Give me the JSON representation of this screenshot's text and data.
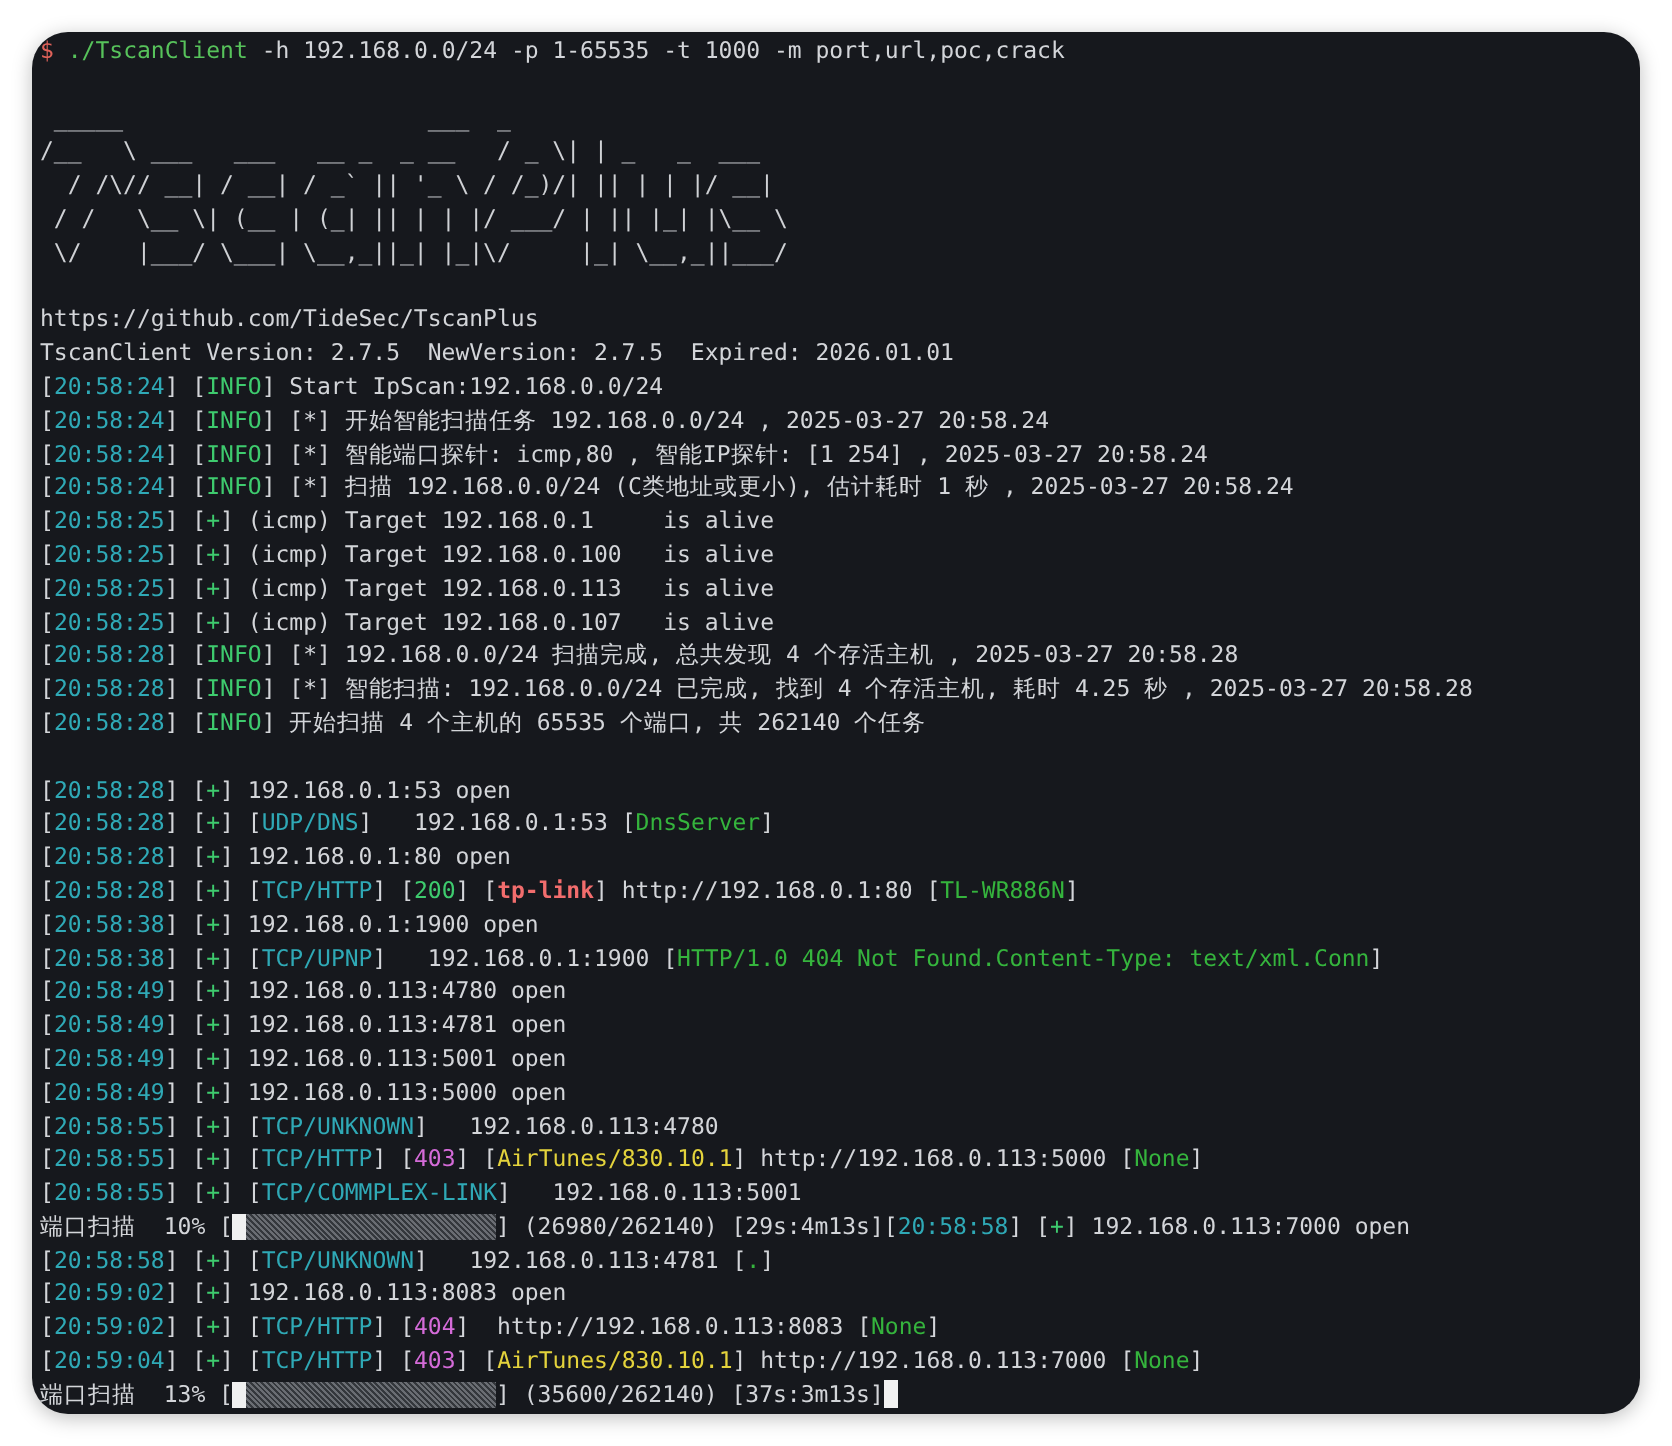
{
  "terminal": {
    "prompt": "$",
    "command": "./TscanClient",
    "arguments": " -h 192.168.0.0/24 -p 1-65535 -t 1000 -m port,url,poc,crack",
    "banner": [
      " _____                      ___  _",
      "/__   \\ ___   ___   __ _  _ __   / _ \\| | _   _  ___",
      "  / /\\// __| / __| / _` || '_ \\ / /_)/| || | | |/ __|",
      " / /   \\__ \\| (__ | (_| || | | |/ ___/ | || |_| |\\__ \\",
      " \\/    |___/ \\___| \\__,_||_| |_|\\/     |_| \\__,_||___/"
    ],
    "lines": [
      {
        "kind": "text",
        "segments": [
          {
            "kind": "plain",
            "text": "https://github.com/TideSec/TscanPlus"
          }
        ]
      },
      {
        "kind": "text",
        "segments": [
          {
            "kind": "plain",
            "text": "TscanClient Version: 2.7.5  NewVersion: 2.7.5  Expired: 2026.01.01"
          }
        ]
      },
      {
        "kind": "text",
        "segments": [
          {
            "kind": "plain",
            "text": "["
          },
          {
            "kind": "time",
            "text": "20:58:24"
          },
          {
            "kind": "plain",
            "text": "] ["
          },
          {
            "kind": "info",
            "text": "INFO"
          },
          {
            "kind": "plain",
            "text": "] Start IpScan:192.168.0.0/24"
          }
        ]
      },
      {
        "kind": "text",
        "segments": [
          {
            "kind": "plain",
            "text": "["
          },
          {
            "kind": "time",
            "text": "20:58:24"
          },
          {
            "kind": "plain",
            "text": "] ["
          },
          {
            "kind": "info",
            "text": "INFO"
          },
          {
            "kind": "plain",
            "text": "] [*] 开始智能扫描任务 192.168.0.0/24 , 2025-03-27 20:58.24"
          }
        ]
      },
      {
        "kind": "text",
        "segments": [
          {
            "kind": "plain",
            "text": "["
          },
          {
            "kind": "time",
            "text": "20:58:24"
          },
          {
            "kind": "plain",
            "text": "] ["
          },
          {
            "kind": "info",
            "text": "INFO"
          },
          {
            "kind": "plain",
            "text": "] [*] 智能端口探针: icmp,80 , 智能IP探针: [1 254] , 2025-03-27 20:58.24"
          }
        ]
      },
      {
        "kind": "text",
        "segments": [
          {
            "kind": "plain",
            "text": "["
          },
          {
            "kind": "time",
            "text": "20:58:24"
          },
          {
            "kind": "plain",
            "text": "] ["
          },
          {
            "kind": "info",
            "text": "INFO"
          },
          {
            "kind": "plain",
            "text": "] [*] 扫描 192.168.0.0/24 (C类地址或更小), 估计耗时 1 秒 , 2025-03-27 20:58.24"
          }
        ]
      },
      {
        "kind": "text",
        "segments": [
          {
            "kind": "plain",
            "text": "["
          },
          {
            "kind": "time",
            "text": "20:58:25"
          },
          {
            "kind": "plain",
            "text": "] ["
          },
          {
            "kind": "info",
            "text": "+"
          },
          {
            "kind": "plain",
            "text": "] (icmp) Target 192.168.0.1     is alive"
          }
        ]
      },
      {
        "kind": "text",
        "segments": [
          {
            "kind": "plain",
            "text": "["
          },
          {
            "kind": "time",
            "text": "20:58:25"
          },
          {
            "kind": "plain",
            "text": "] ["
          },
          {
            "kind": "info",
            "text": "+"
          },
          {
            "kind": "plain",
            "text": "] (icmp) Target 192.168.0.100   is alive"
          }
        ]
      },
      {
        "kind": "text",
        "segments": [
          {
            "kind": "plain",
            "text": "["
          },
          {
            "kind": "time",
            "text": "20:58:25"
          },
          {
            "kind": "plain",
            "text": "] ["
          },
          {
            "kind": "info",
            "text": "+"
          },
          {
            "kind": "plain",
            "text": "] (icmp) Target 192.168.0.113   is alive"
          }
        ]
      },
      {
        "kind": "text",
        "segments": [
          {
            "kind": "plain",
            "text": "["
          },
          {
            "kind": "time",
            "text": "20:58:25"
          },
          {
            "kind": "plain",
            "text": "] ["
          },
          {
            "kind": "info",
            "text": "+"
          },
          {
            "kind": "plain",
            "text": "] (icmp) Target 192.168.0.107   is alive"
          }
        ]
      },
      {
        "kind": "text",
        "segments": [
          {
            "kind": "plain",
            "text": "["
          },
          {
            "kind": "time",
            "text": "20:58:28"
          },
          {
            "kind": "plain",
            "text": "] ["
          },
          {
            "kind": "info",
            "text": "INFO"
          },
          {
            "kind": "plain",
            "text": "] [*] 192.168.0.0/24 扫描完成, 总共发现 4 个存活主机 , 2025-03-27 20:58.28"
          }
        ]
      },
      {
        "kind": "text",
        "segments": [
          {
            "kind": "plain",
            "text": "["
          },
          {
            "kind": "time",
            "text": "20:58:28"
          },
          {
            "kind": "plain",
            "text": "] ["
          },
          {
            "kind": "info",
            "text": "INFO"
          },
          {
            "kind": "plain",
            "text": "] [*] 智能扫描: 192.168.0.0/24 已完成, 找到 4 个存活主机, 耗时 4.25 秒 , 2025-03-27 20:58.28"
          }
        ]
      },
      {
        "kind": "text",
        "segments": [
          {
            "kind": "plain",
            "text": "["
          },
          {
            "kind": "time",
            "text": "20:58:28"
          },
          {
            "kind": "plain",
            "text": "] ["
          },
          {
            "kind": "info",
            "text": "INFO"
          },
          {
            "kind": "plain",
            "text": "] 开始扫描 4 个主机的 65535 个端口, 共 262140 个任务"
          }
        ]
      },
      {
        "kind": "blank"
      },
      {
        "kind": "text",
        "segments": [
          {
            "kind": "plain",
            "text": "["
          },
          {
            "kind": "time",
            "text": "20:58:28"
          },
          {
            "kind": "plain",
            "text": "] ["
          },
          {
            "kind": "info",
            "text": "+"
          },
          {
            "kind": "plain",
            "text": "] 192.168.0.1:53 open"
          }
        ]
      },
      {
        "kind": "text",
        "segments": [
          {
            "kind": "plain",
            "text": "["
          },
          {
            "kind": "time",
            "text": "20:58:28"
          },
          {
            "kind": "plain",
            "text": "] ["
          },
          {
            "kind": "info",
            "text": "+"
          },
          {
            "kind": "plain",
            "text": "] ["
          },
          {
            "kind": "tag",
            "text": "UDP/DNS"
          },
          {
            "kind": "plain",
            "text": "]   192.168.0.1:53 ["
          },
          {
            "kind": "green",
            "text": "DnsServer"
          },
          {
            "kind": "plain",
            "text": "]"
          }
        ]
      },
      {
        "kind": "text",
        "segments": [
          {
            "kind": "plain",
            "text": "["
          },
          {
            "kind": "time",
            "text": "20:58:28"
          },
          {
            "kind": "plain",
            "text": "] ["
          },
          {
            "kind": "info",
            "text": "+"
          },
          {
            "kind": "plain",
            "text": "] 192.168.0.1:80 open"
          }
        ]
      },
      {
        "kind": "text",
        "segments": [
          {
            "kind": "plain",
            "text": "["
          },
          {
            "kind": "time",
            "text": "20:58:28"
          },
          {
            "kind": "plain",
            "text": "] ["
          },
          {
            "kind": "info",
            "text": "+"
          },
          {
            "kind": "plain",
            "text": "] ["
          },
          {
            "kind": "tag",
            "text": "TCP/HTTP"
          },
          {
            "kind": "plain",
            "text": "] ["
          },
          {
            "kind": "info",
            "text": "200"
          },
          {
            "kind": "plain",
            "text": "] ["
          },
          {
            "kind": "red",
            "text": "tp-link"
          },
          {
            "kind": "plain",
            "text": "] http://192.168.0.1:80 ["
          },
          {
            "kind": "green",
            "text": "TL-WR886N"
          },
          {
            "kind": "plain",
            "text": "]"
          }
        ]
      },
      {
        "kind": "text",
        "segments": [
          {
            "kind": "plain",
            "text": "["
          },
          {
            "kind": "time",
            "text": "20:58:38"
          },
          {
            "kind": "plain",
            "text": "] ["
          },
          {
            "kind": "info",
            "text": "+"
          },
          {
            "kind": "plain",
            "text": "] 192.168.0.1:1900 open"
          }
        ]
      },
      {
        "kind": "text",
        "segments": [
          {
            "kind": "plain",
            "text": "["
          },
          {
            "kind": "time",
            "text": "20:58:38"
          },
          {
            "kind": "plain",
            "text": "] ["
          },
          {
            "kind": "info",
            "text": "+"
          },
          {
            "kind": "plain",
            "text": "] ["
          },
          {
            "kind": "tag",
            "text": "TCP/UPNP"
          },
          {
            "kind": "plain",
            "text": "]   192.168.0.1:1900 ["
          },
          {
            "kind": "green",
            "text": "HTTP/1.0 404 Not Found.Content-Type: text/xml.Conn"
          },
          {
            "kind": "plain",
            "text": "]"
          }
        ]
      },
      {
        "kind": "text",
        "segments": [
          {
            "kind": "plain",
            "text": "["
          },
          {
            "kind": "time",
            "text": "20:58:49"
          },
          {
            "kind": "plain",
            "text": "] ["
          },
          {
            "kind": "info",
            "text": "+"
          },
          {
            "kind": "plain",
            "text": "] 192.168.0.113:4780 open"
          }
        ]
      },
      {
        "kind": "text",
        "segments": [
          {
            "kind": "plain",
            "text": "["
          },
          {
            "kind": "time",
            "text": "20:58:49"
          },
          {
            "kind": "plain",
            "text": "] ["
          },
          {
            "kind": "info",
            "text": "+"
          },
          {
            "kind": "plain",
            "text": "] 192.168.0.113:4781 open"
          }
        ]
      },
      {
        "kind": "text",
        "segments": [
          {
            "kind": "plain",
            "text": "["
          },
          {
            "kind": "time",
            "text": "20:58:49"
          },
          {
            "kind": "plain",
            "text": "] ["
          },
          {
            "kind": "info",
            "text": "+"
          },
          {
            "kind": "plain",
            "text": "] 192.168.0.113:5001 open"
          }
        ]
      },
      {
        "kind": "text",
        "segments": [
          {
            "kind": "plain",
            "text": "["
          },
          {
            "kind": "time",
            "text": "20:58:49"
          },
          {
            "kind": "plain",
            "text": "] ["
          },
          {
            "kind": "info",
            "text": "+"
          },
          {
            "kind": "plain",
            "text": "] 192.168.0.113:5000 open"
          }
        ]
      },
      {
        "kind": "text",
        "segments": [
          {
            "kind": "plain",
            "text": "["
          },
          {
            "kind": "time",
            "text": "20:58:55"
          },
          {
            "kind": "plain",
            "text": "] ["
          },
          {
            "kind": "info",
            "text": "+"
          },
          {
            "kind": "plain",
            "text": "] ["
          },
          {
            "kind": "tag",
            "text": "TCP/UNKNOWN"
          },
          {
            "kind": "plain",
            "text": "]   192.168.0.113:4780"
          }
        ]
      },
      {
        "kind": "text",
        "segments": [
          {
            "kind": "plain",
            "text": "["
          },
          {
            "kind": "time",
            "text": "20:58:55"
          },
          {
            "kind": "plain",
            "text": "] ["
          },
          {
            "kind": "info",
            "text": "+"
          },
          {
            "kind": "plain",
            "text": "] ["
          },
          {
            "kind": "tag",
            "text": "TCP/HTTP"
          },
          {
            "kind": "plain",
            "text": "] ["
          },
          {
            "kind": "magenta",
            "text": "403"
          },
          {
            "kind": "plain",
            "text": "] ["
          },
          {
            "kind": "yellow",
            "text": "AirTunes/830.10.1"
          },
          {
            "kind": "plain",
            "text": "] http://192.168.0.113:5000 ["
          },
          {
            "kind": "green",
            "text": "None"
          },
          {
            "kind": "plain",
            "text": "]"
          }
        ]
      },
      {
        "kind": "text",
        "segments": [
          {
            "kind": "plain",
            "text": "["
          },
          {
            "kind": "time",
            "text": "20:58:55"
          },
          {
            "kind": "plain",
            "text": "] ["
          },
          {
            "kind": "info",
            "text": "+"
          },
          {
            "kind": "plain",
            "text": "] ["
          },
          {
            "kind": "tag",
            "text": "TCP/COMMPLEX-LINK"
          },
          {
            "kind": "plain",
            "text": "]   192.168.0.113:5001"
          }
        ]
      },
      {
        "kind": "progress",
        "before": [
          {
            "kind": "plain",
            "text": "端口扫描  10% ["
          }
        ],
        "level": 0.05,
        "after": [
          {
            "kind": "plain",
            "text": "] (26980/262140) [29s:4m13s]["
          },
          {
            "kind": "time",
            "text": "20:58:58"
          },
          {
            "kind": "plain",
            "text": "] ["
          },
          {
            "kind": "info",
            "text": "+"
          },
          {
            "kind": "plain",
            "text": "] 192.168.0.113:7000 open"
          }
        ]
      },
      {
        "kind": "text",
        "segments": [
          {
            "kind": "plain",
            "text": "["
          },
          {
            "kind": "time",
            "text": "20:58:58"
          },
          {
            "kind": "plain",
            "text": "] ["
          },
          {
            "kind": "info",
            "text": "+"
          },
          {
            "kind": "plain",
            "text": "] ["
          },
          {
            "kind": "tag",
            "text": "TCP/UNKNOWN"
          },
          {
            "kind": "plain",
            "text": "]   192.168.0.113:4781 ["
          },
          {
            "kind": "green",
            "text": "."
          },
          {
            "kind": "plain",
            "text": "]"
          }
        ]
      },
      {
        "kind": "text",
        "segments": [
          {
            "kind": "plain",
            "text": "["
          },
          {
            "kind": "time",
            "text": "20:59:02"
          },
          {
            "kind": "plain",
            "text": "] ["
          },
          {
            "kind": "info",
            "text": "+"
          },
          {
            "kind": "plain",
            "text": "] 192.168.0.113:8083 open"
          }
        ]
      },
      {
        "kind": "text",
        "segments": [
          {
            "kind": "plain",
            "text": "["
          },
          {
            "kind": "time",
            "text": "20:59:02"
          },
          {
            "kind": "plain",
            "text": "] ["
          },
          {
            "kind": "info",
            "text": "+"
          },
          {
            "kind": "plain",
            "text": "] ["
          },
          {
            "kind": "tag",
            "text": "TCP/HTTP"
          },
          {
            "kind": "plain",
            "text": "] ["
          },
          {
            "kind": "magenta",
            "text": "404"
          },
          {
            "kind": "plain",
            "text": "]  http://192.168.0.113:8083 ["
          },
          {
            "kind": "green",
            "text": "None"
          },
          {
            "kind": "plain",
            "text": "]"
          }
        ]
      },
      {
        "kind": "text",
        "segments": [
          {
            "kind": "plain",
            "text": "["
          },
          {
            "kind": "time",
            "text": "20:59:04"
          },
          {
            "kind": "plain",
            "text": "] ["
          },
          {
            "kind": "info",
            "text": "+"
          },
          {
            "kind": "plain",
            "text": "] ["
          },
          {
            "kind": "tag",
            "text": "TCP/HTTP"
          },
          {
            "kind": "plain",
            "text": "] ["
          },
          {
            "kind": "magenta",
            "text": "403"
          },
          {
            "kind": "plain",
            "text": "] ["
          },
          {
            "kind": "yellow",
            "text": "AirTunes/830.10.1"
          },
          {
            "kind": "plain",
            "text": "] http://192.168.0.113:7000 ["
          },
          {
            "kind": "green",
            "text": "None"
          },
          {
            "kind": "plain",
            "text": "]"
          }
        ]
      },
      {
        "kind": "progress",
        "before": [
          {
            "kind": "plain",
            "text": "端口扫描  13% ["
          }
        ],
        "level": 0.05,
        "after": [
          {
            "kind": "plain",
            "text": "] (35600/262140) [37s:3m13s]"
          }
        ],
        "cursor": true
      }
    ]
  }
}
